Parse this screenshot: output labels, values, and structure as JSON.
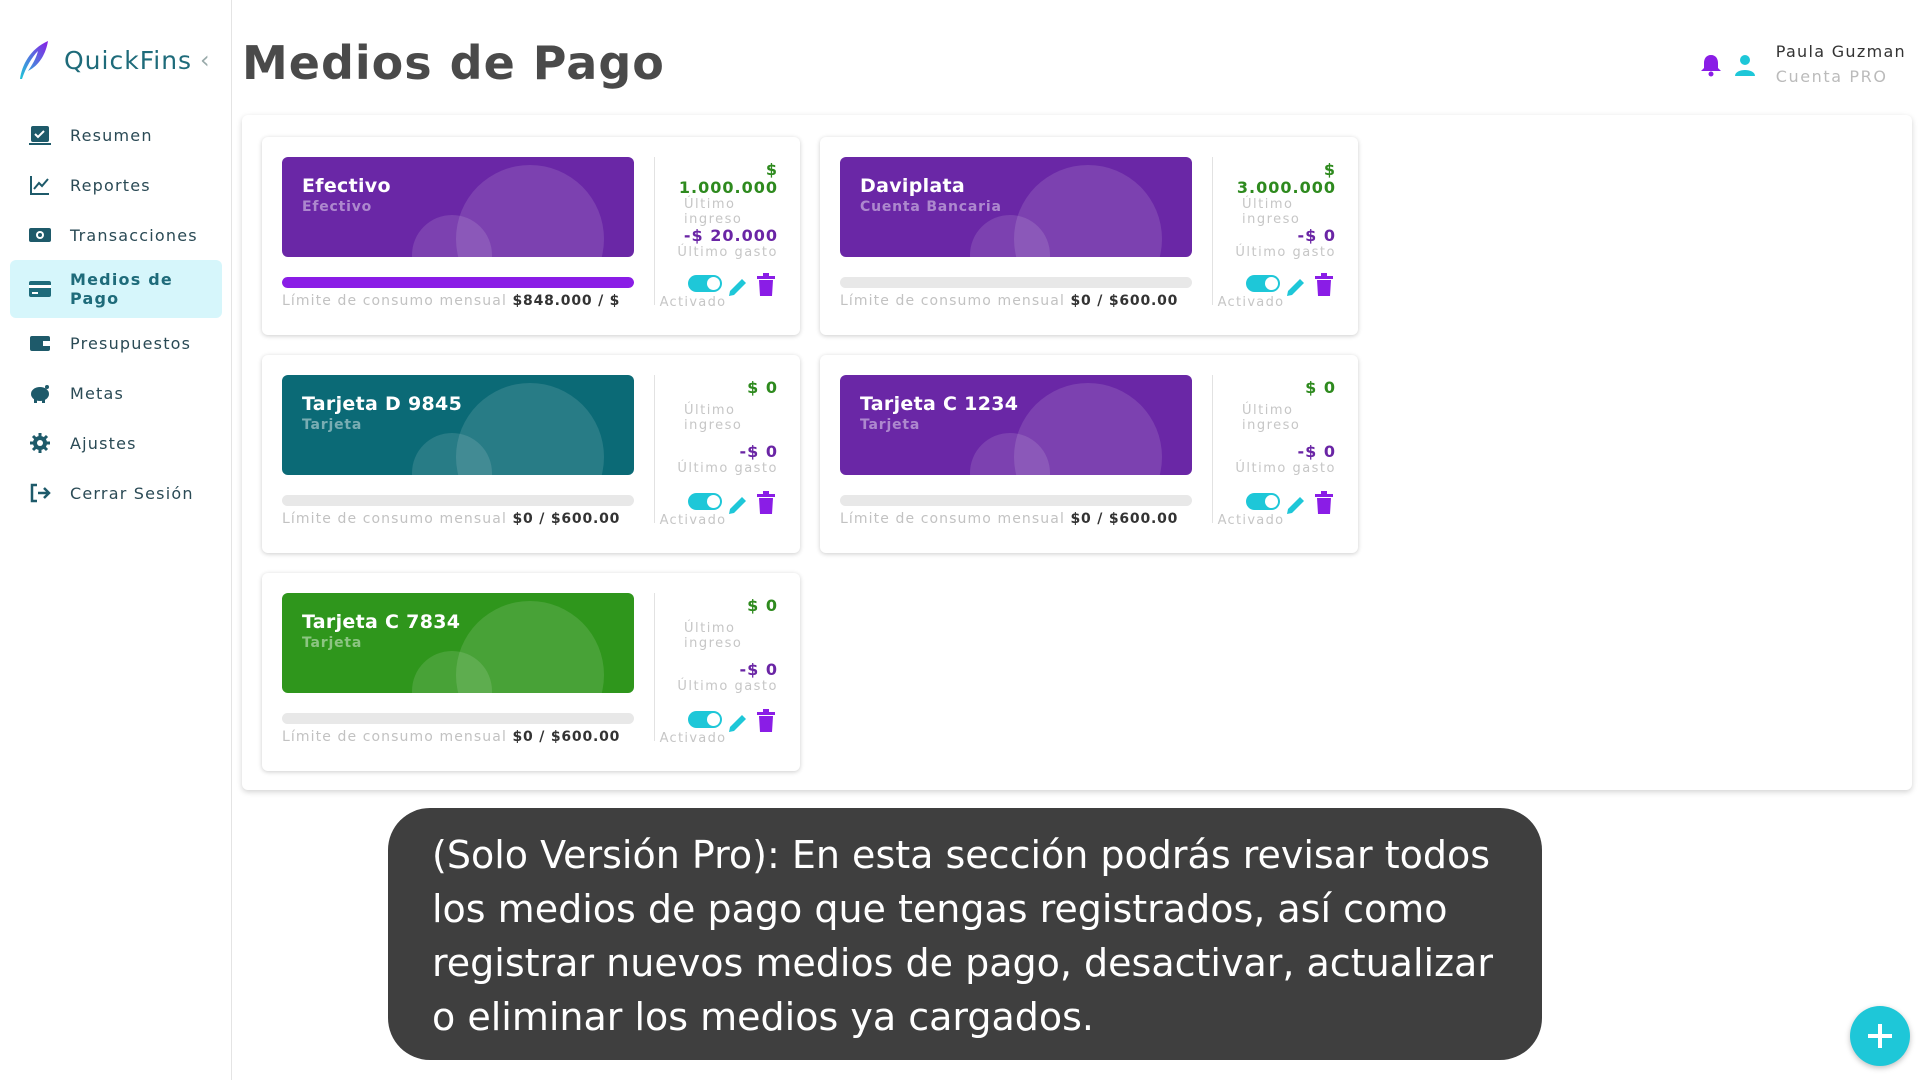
{
  "brand": {
    "name": "QuickFins"
  },
  "sidebar": {
    "items": [
      {
        "label": "Resumen",
        "icon": "summary-icon"
      },
      {
        "label": "Reportes",
        "icon": "chart-line-icon"
      },
      {
        "label": "Transacciones",
        "icon": "money-icon"
      },
      {
        "label": "Medios de Pago",
        "icon": "credit-card-icon",
        "active": true
      },
      {
        "label": "Presupuestos",
        "icon": "wallet-icon"
      },
      {
        "label": "Metas",
        "icon": "piggy-bank-icon"
      },
      {
        "label": "Ajustes",
        "icon": "gear-icon"
      },
      {
        "label": "Cerrar Sesión",
        "icon": "logout-icon"
      }
    ]
  },
  "header": {
    "title": "Medios de Pago",
    "user": {
      "name": "Paula Guzman",
      "plan": "Cuenta PRO"
    }
  },
  "card_labels": {
    "limit": "Límite de consumo mensual",
    "last_income": "Último ingreso",
    "last_expense": "Último gasto",
    "status": "Activado"
  },
  "cards": [
    {
      "name": "Efectivo",
      "type": "Efectivo",
      "color": "#6a27a6",
      "income_symbol": "$",
      "income": "1.000.000",
      "expense": "-$ 20.000",
      "limit_value": "$848.000 / $",
      "progress": 1.0,
      "active": true
    },
    {
      "name": "Daviplata",
      "type": "Cuenta Bancaria",
      "color": "#6a27a6",
      "income_symbol": "$",
      "income": "3.000.000",
      "expense": "-$ 0",
      "limit_value": "$0 / $600.00",
      "progress": 0,
      "active": true
    },
    {
      "name": "Tarjeta D 9845",
      "type": "Tarjeta",
      "color": "#0b6a76",
      "income_symbol": "",
      "income": "$ 0",
      "expense": "-$ 0",
      "limit_value": "$0 / $600.00",
      "progress": 0,
      "active": true
    },
    {
      "name": "Tarjeta C 1234",
      "type": "Tarjeta",
      "color": "#6a27a6",
      "income_symbol": "",
      "income": "$ 0",
      "expense": "-$ 0",
      "limit_value": "$0 / $600.00",
      "progress": 0,
      "active": true
    },
    {
      "name": "Tarjeta C 7834",
      "type": "Tarjeta",
      "color": "#2f961c",
      "income_symbol": "",
      "income": "$ 0",
      "expense": "-$ 0",
      "limit_value": "$0 / $600.00",
      "progress": 0,
      "active": true
    }
  ],
  "tutorial": {
    "text": "(Solo Versión Pro): En esta sección podrás revisar todos los medios de pago que tengas registrados, así como registrar nuevos medios de pago, desactivar, actualizar o eliminar los medios ya cargados."
  },
  "fab": {
    "label": "+",
    "icon": "plus-icon"
  },
  "colors": {
    "accent": "#1ec7d8",
    "purple": "#8a1de6",
    "income": "#2e8a1e",
    "expense": "#6a25a5"
  }
}
